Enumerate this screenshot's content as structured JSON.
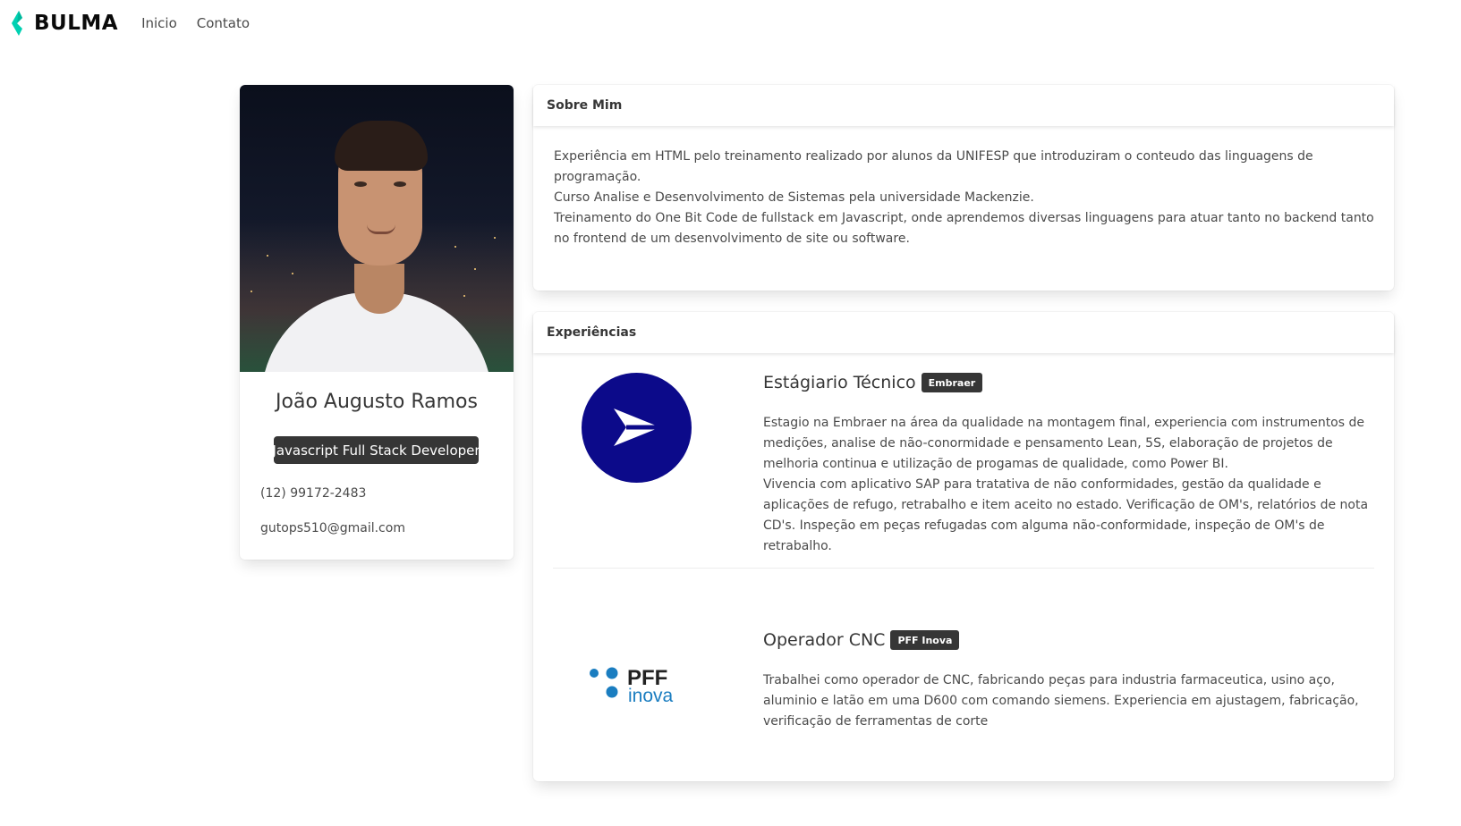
{
  "navbar": {
    "brand": "BULMA",
    "links": [
      "Inicio",
      "Contato"
    ]
  },
  "profile": {
    "name": "João Augusto Ramos",
    "role": "Javascript Full Stack Developer",
    "phone": "(12) 99172-2483",
    "email": "gutops510@gmail.com"
  },
  "about": {
    "title": "Sobre Mim",
    "paragraphs": [
      "Experiência em HTML pelo treinamento realizado por alunos da UNIFESP que introduziram o conteudo das linguagens de programação.",
      "Curso Analise e Desenvolvimento de Sistemas pela universidade Mackenzie.",
      "Treinamento do One Bit Code de fullstack em Javascript, onde aprendemos diversas linguagens para atuar tanto no backend tanto no frontend de um desenvolvimento de site ou software."
    ]
  },
  "experiences": {
    "title": "Experiências",
    "items": [
      {
        "position": "Estágiario Técnico",
        "company": "Embraer",
        "paragraphs": [
          "Estagio na Embraer na área da qualidade na montagem final, experiencia com instrumentos de medições, analise de não-conormidade e pensamento Lean, 5S, elaboração de projetos de melhoria continua e utilização de progamas de qualidade, como Power BI.",
          "Vivencia com aplicativo SAP para tratativa de não conformidades, gestão da qualidade e aplicações de refugo, retrabalho e item aceito no estado. Verificação de OM's, relatórios de nota CD's. Inspeção em peças refugadas com alguma não-conformidade, inspeção de OM's de retrabalho."
        ]
      },
      {
        "position": "Operador CNC",
        "company": "PFF Inova",
        "paragraphs": [
          "Trabalhei como operador de CNC, fabricando peças para industria farmaceutica, usino aço, aluminio e latão em uma D600 com comando siemens. Experiencia em ajustagem, fabricação, verificação de ferramentas de corte"
        ]
      }
    ],
    "pff_logo_text": [
      "PFF",
      "inova"
    ]
  },
  "colors": {
    "brand_accent": "#00d1b2",
    "dark_tag": "#363636",
    "embraer_blue": "#0c0a8a",
    "pff_blue": "#1a7dc0"
  }
}
